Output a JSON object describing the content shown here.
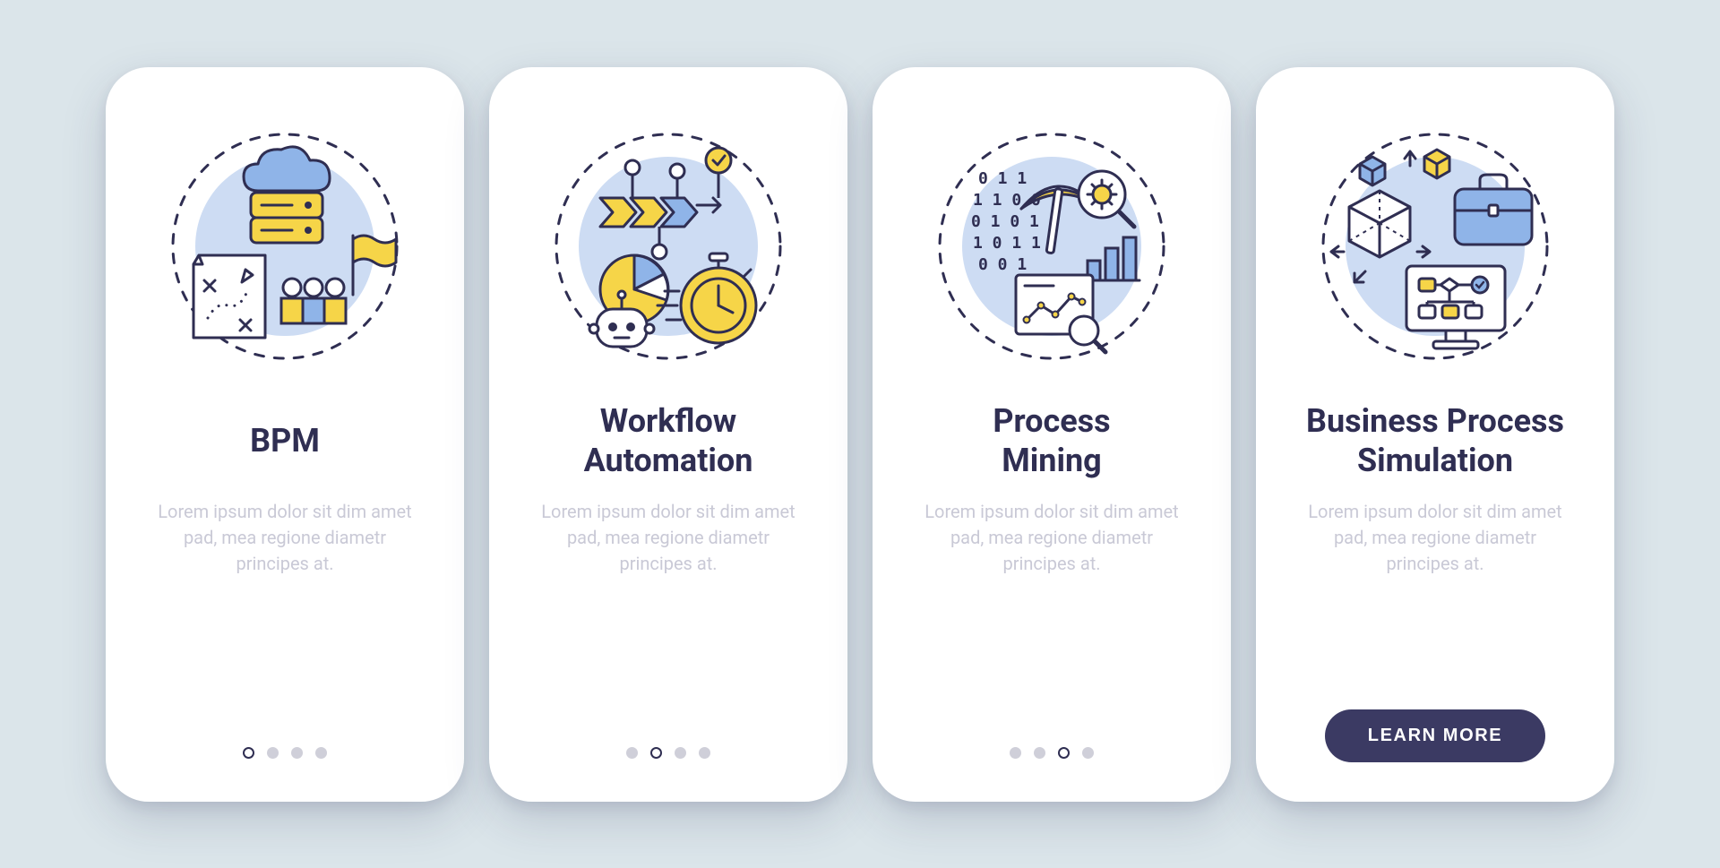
{
  "colors": {
    "stroke": "#2f2e52",
    "yellow": "#f6d548",
    "blue": "#8fb4e8",
    "lightblue": "#cddcf3",
    "white": "#ffffff",
    "gray": "#cfcfd9"
  },
  "screens": [
    {
      "icon": "bpm",
      "title": "BPM",
      "description": "Lorem ipsum dolor sit dim amet pad, mea regione diametr principes at.",
      "active_dot": 0,
      "show_dots": true,
      "show_cta": false
    },
    {
      "icon": "workflow",
      "title": "Workflow\nAutomation",
      "description": "Lorem ipsum dolor sit dim amet pad, mea regione diametr principes at.",
      "active_dot": 1,
      "show_dots": true,
      "show_cta": false
    },
    {
      "icon": "mining",
      "title": "Process\nMining",
      "description": "Lorem ipsum dolor sit dim amet pad, mea regione diametr principes at.",
      "active_dot": 2,
      "show_dots": true,
      "show_cta": false
    },
    {
      "icon": "simulation",
      "title": "Business Process\nSimulation",
      "description": "Lorem ipsum dolor sit dim amet pad, mea regione diametr principes at.",
      "active_dot": 3,
      "show_dots": false,
      "show_cta": true
    }
  ],
  "cta_label": "LEARN MORE",
  "total_dots": 4
}
